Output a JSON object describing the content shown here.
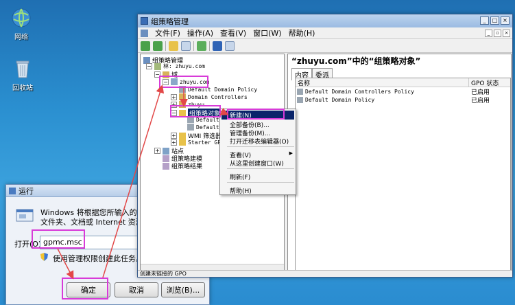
{
  "desktop": {
    "icons": [
      {
        "name": "network",
        "label": "网络",
        "icon": "globe-icon"
      },
      {
        "name": "recycle-bin",
        "label": "回收站",
        "icon": "trash-icon"
      }
    ]
  },
  "run_dialog": {
    "title": "运行",
    "message_line1": "Windows 将根据您所输入的名称，为",
    "message_line2": "文件夹、文档或 Internet 资源。",
    "open_label": "打开(O):",
    "open_value": "gpmc.msc",
    "admin_note": "使用管理权限创建此任务。",
    "ok": "确定",
    "cancel": "取消",
    "browse": "浏览(B)..."
  },
  "gpmc": {
    "title": "组策略管理",
    "menu": [
      "文件(F)",
      "操作(A)",
      "查看(V)",
      "窗口(W)",
      "帮助(H)"
    ],
    "tree": {
      "root": "组策略管理",
      "forest": "林: zhuyu.com",
      "domains": "域",
      "domain": "zhuyu.com",
      "default_policy": "Default Domain Policy",
      "domain_controllers": "Domain Controllers",
      "ou": "zhuyu",
      "gpo_folder": "组策略对象",
      "gpo_child1": "Default",
      "gpo_child2": "Default",
      "wmi": "WMI 筛选器",
      "starter": "Starter GPO",
      "sites": "站点",
      "modeling": "组策略建模",
      "results": "组策略结果"
    },
    "right": {
      "heading": "“zhuyu.com”中的“组策略对象”",
      "tabs": [
        "内容",
        "委派"
      ],
      "columns": [
        "名称",
        "GPO 状态"
      ],
      "rows": [
        {
          "name": "Default Domain Controllers Policy",
          "status": "已启用"
        },
        {
          "name": "Default Domain Policy",
          "status": "已启用"
        }
      ]
    },
    "status": "创建未链接的 GPO"
  },
  "context_menu": {
    "items": [
      "新建(N)",
      "全部备份(B)...",
      "管理备份(M)...",
      "打开迁移表编辑器(O)",
      "查看(V)",
      "从这里创建窗口(W)",
      "刷新(F)",
      "帮助(H)"
    ]
  },
  "colors": {
    "highlight": "#d83bd8",
    "arrow": "#e24848",
    "selection": "#0a246a"
  }
}
